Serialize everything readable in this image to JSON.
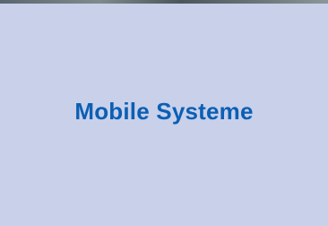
{
  "tile": {
    "title": "Mobile Systeme"
  },
  "colors": {
    "background": "#c8d0ea",
    "title_text": "#0b5fb4"
  }
}
